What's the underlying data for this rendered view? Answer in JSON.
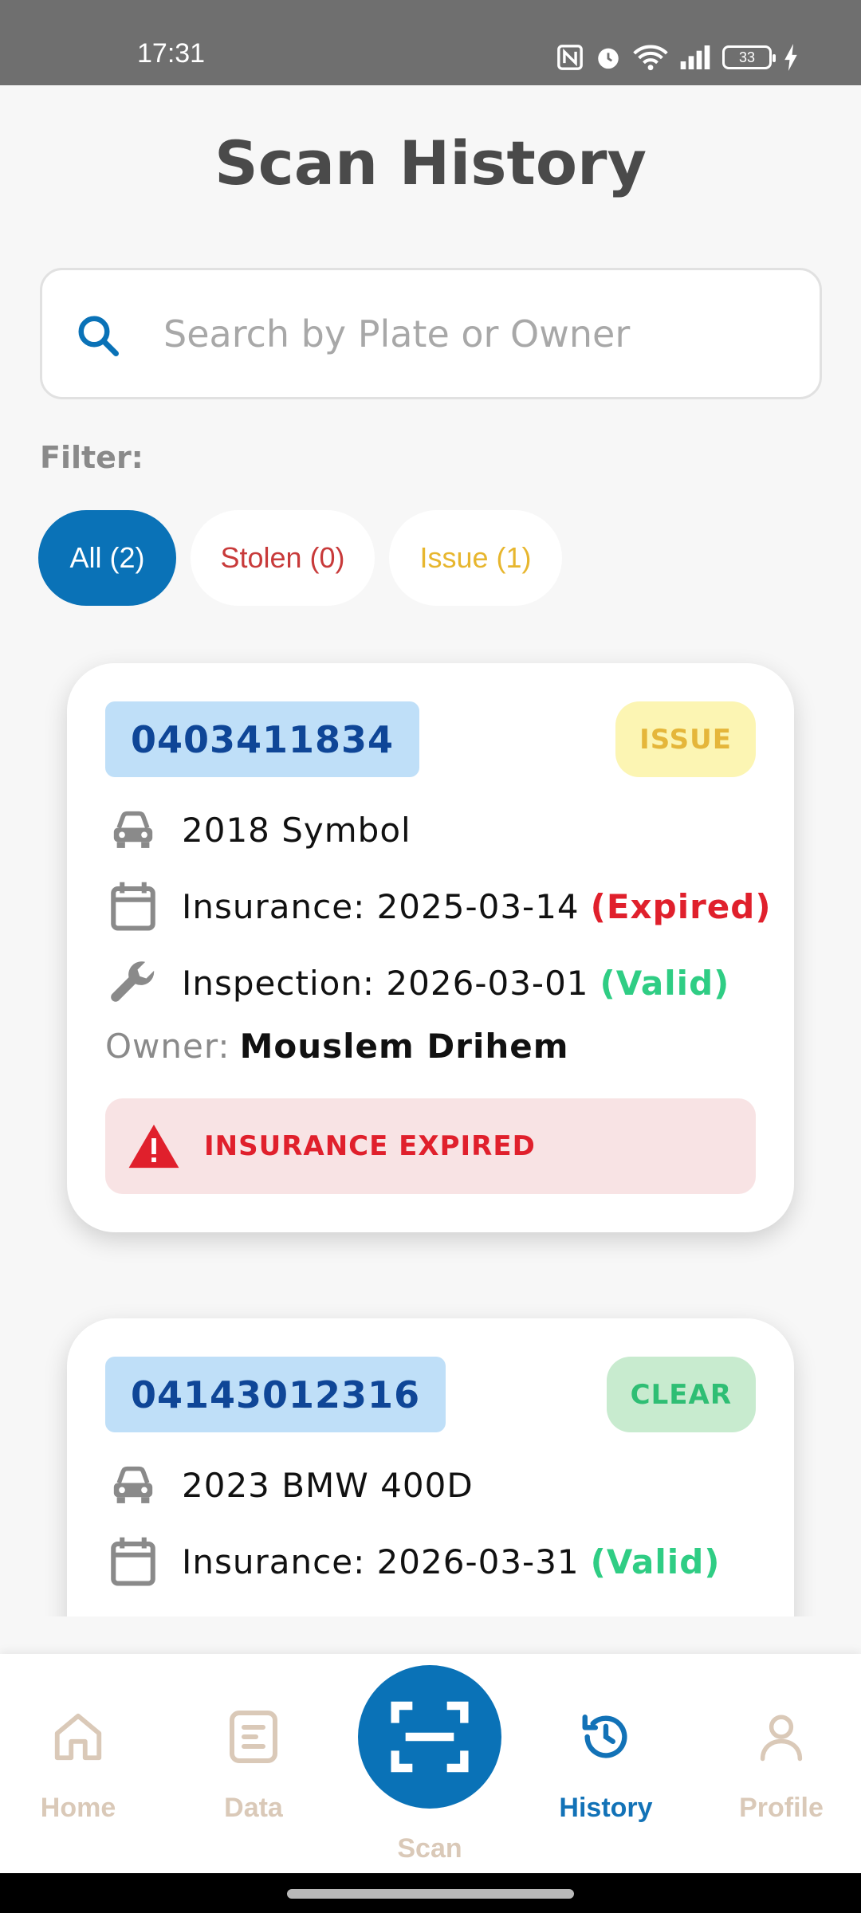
{
  "status_bar": {
    "time": "17:31",
    "battery": "33"
  },
  "page": {
    "title": "Scan History"
  },
  "search": {
    "placeholder": "Search by Plate or Owner",
    "value": ""
  },
  "filter": {
    "label": "Filter:",
    "chips": [
      {
        "label": "All (2)",
        "selected": true
      },
      {
        "label": "Stolen (0)",
        "selected": false
      },
      {
        "label": "Issue (1)",
        "selected": false
      }
    ]
  },
  "records": [
    {
      "plate": "0403411834",
      "badge": "ISSUE",
      "vehicle": "2018 Symbol",
      "insurance_label": "Insurance: 2025-03-14",
      "insurance_status": "(Expired)",
      "inspection_label": "Inspection: 2026-03-01",
      "inspection_status": "(Valid)",
      "owner_label": "Owner:",
      "owner_name": "Mouslem Drihem",
      "alert": "INSURANCE EXPIRED"
    },
    {
      "plate": "04143012316",
      "badge": "CLEAR",
      "vehicle": "2023 BMW 400D",
      "insurance_label": "Insurance: 2026-03-31",
      "insurance_status": "(Valid)"
    }
  ],
  "nav": {
    "items": [
      {
        "label": "Home",
        "icon": "home-icon"
      },
      {
        "label": "Data",
        "icon": "document-icon"
      },
      {
        "label": "Scan",
        "icon": "scan-icon"
      },
      {
        "label": "History",
        "icon": "history-icon",
        "active": true
      },
      {
        "label": "Profile",
        "icon": "person-icon"
      }
    ]
  },
  "colors": {
    "primary": "#0a72b7",
    "plate_bg": "#bfdff8",
    "plate_text": "#0f4697",
    "danger": "#e0202c",
    "success": "#2fcd84",
    "warning": "#e5b63a",
    "nav_inactive": "#dac9b8"
  }
}
